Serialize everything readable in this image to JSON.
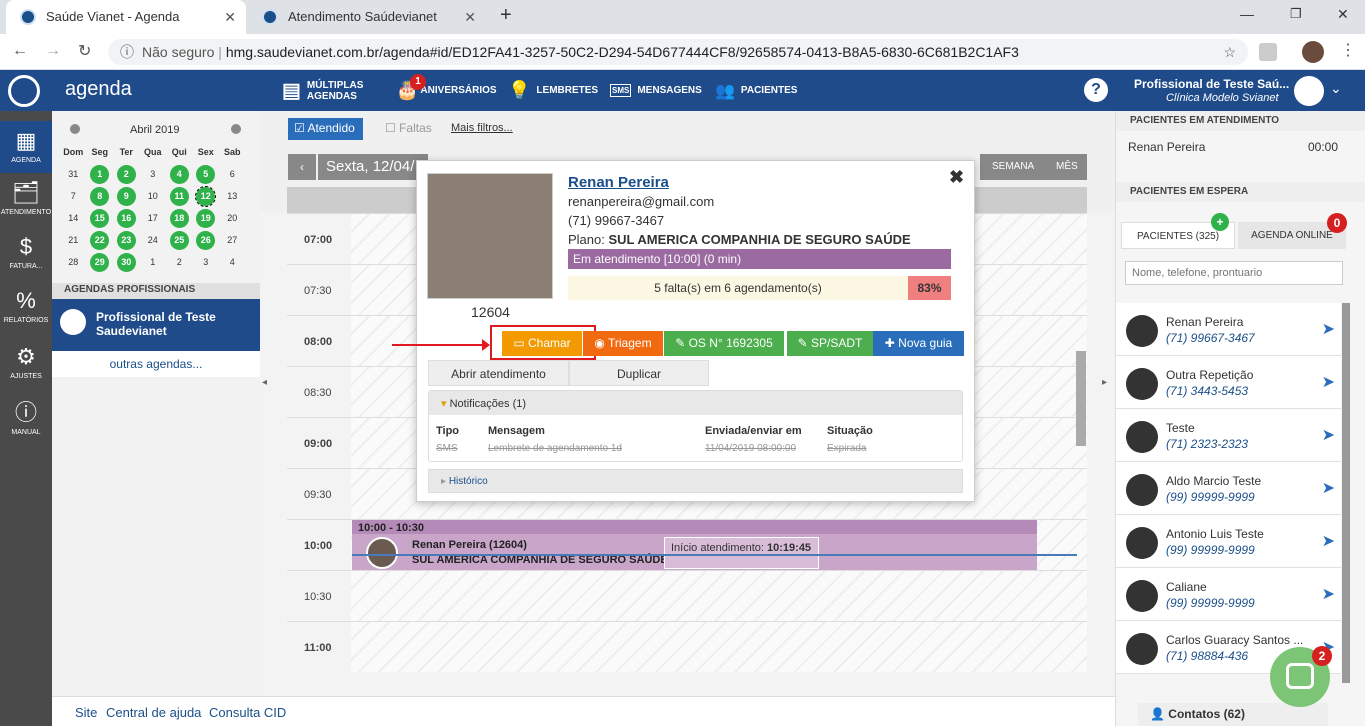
{
  "browser": {
    "tabs": [
      {
        "title": "Saúde Vianet - Agenda"
      },
      {
        "title": "Atendimento Saúdevianet"
      }
    ],
    "security": "Não seguro",
    "url": "hmg.saudevianet.com.br/agenda#id/ED12FA41-3257-50C2-D294-54D677444CF8/92658574-0413-B8A5-6830-6C681B2C1AF3"
  },
  "header": {
    "app": "agenda",
    "nav": [
      {
        "l1": "MÚLTIPLAS",
        "l2": "AGENDAS"
      },
      {
        "label": "ANIVERSÁRIOS",
        "badge": "1"
      },
      {
        "label": "LEMBRETES"
      },
      {
        "label": "MENSAGENS"
      },
      {
        "label": "PACIENTES"
      }
    ],
    "user": "Profissional de Teste Saú...",
    "clinic": "Clínica Modelo Svianet"
  },
  "leftbar": [
    "AGENDA",
    "ATENDIMENTO",
    "FATURA...",
    "RELATÓRIOS",
    "AJUSTES",
    "MANUAL"
  ],
  "calendar": {
    "month": "Abril 2019",
    "dow": [
      "Dom",
      "Seg",
      "Ter",
      "Qua",
      "Qui",
      "Sex",
      "Sab"
    ],
    "weeks": [
      [
        "31",
        "1",
        "2",
        "3",
        "4",
        "5",
        "6"
      ],
      [
        "7",
        "8",
        "9",
        "10",
        "11",
        "12",
        "13"
      ],
      [
        "14",
        "15",
        "16",
        "17",
        "18",
        "19",
        "20"
      ],
      [
        "21",
        "22",
        "23",
        "24",
        "25",
        "26",
        "27"
      ],
      [
        "28",
        "29",
        "30",
        "1",
        "2",
        "3",
        "4"
      ]
    ],
    "green": [
      "1",
      "2",
      "4",
      "5",
      "8",
      "9",
      "11",
      "12",
      "15",
      "16",
      "18",
      "19",
      "22",
      "23",
      "25",
      "26",
      "29",
      "30"
    ]
  },
  "sidebar": {
    "section": "AGENDAS PROFISSIONAIS",
    "prof": "Profissional de Teste Saudevianet",
    "other": "outras agendas..."
  },
  "filters": {
    "atendido": "Atendido",
    "faltas": "Faltas",
    "mais": "Mais filtros..."
  },
  "toolbar": {
    "date": "Sexta, 12/04/",
    "semana": "SEMANA",
    "mes": "MÊS"
  },
  "times": [
    "07:00",
    "07:30",
    "08:00",
    "08:30",
    "09:00",
    "09:30",
    "10:00",
    "10:30",
    "11:00"
  ],
  "appointment": {
    "time": "10:00 - 10:30",
    "patient": "Renan Pereira (12604)",
    "plan": "SUL AMERICA COMPANHIA DE SEGURO SAÚDE",
    "start_label": "Início atendimento:",
    "start_time": "10:19:45"
  },
  "popup": {
    "name": "Renan Pereira",
    "email": "renanpereira@gmail.com",
    "phone": "(71) 99667-3467",
    "plan_label": "Plano:",
    "plan": "SUL AMERICA COMPANHIA DE SEGURO SAÚDE",
    "status": "Em atendimento [10:00] (0 min)",
    "faltas": "5 falta(s) em 6 agendamento(s)",
    "pct": "83%",
    "id": "12604",
    "btns": [
      "Chamar",
      "Triagem",
      "OS N° 1692305",
      "SP/SADT",
      "Nova guia"
    ],
    "abrir": "Abrir atendimento",
    "duplicar": "Duplicar",
    "notif": "Notificações (1)",
    "cols": [
      "Tipo",
      "Mensagem",
      "Enviada/enviar em",
      "Situação"
    ],
    "row": [
      "SMS",
      "Lembrete de agendamento 1d",
      "11/04/2019 08:00:00",
      "Expirada"
    ],
    "hist": "Histórico"
  },
  "right": {
    "em_atend": "PACIENTES EM ATENDIMENTO",
    "atend_name": "Renan Pereira",
    "atend_time": "00:00",
    "espera": "PACIENTES EM ESPERA",
    "tab1": "PACIENTES (325)",
    "tab2": "AGENDA ONLINE",
    "tab2badge": "0",
    "search": "Nome, telefone, prontuario",
    "patients": [
      {
        "n": "Renan Pereira",
        "p": "(71) 99667-3467"
      },
      {
        "n": "Outra Repetição",
        "p": "(71) 3443-5453"
      },
      {
        "n": "Teste",
        "p": "(71) 2323-2323"
      },
      {
        "n": "Aldo Marcio Teste",
        "p": "(99) 99999-9999"
      },
      {
        "n": "Antonio Luis Teste",
        "p": "(99) 99999-9999"
      },
      {
        "n": "Caliane",
        "p": "(99) 99999-9999"
      },
      {
        "n": "Carlos Guaracy Santos ...",
        "p": "(71) 98884-436"
      }
    ],
    "contatos": "Contatos (62)",
    "chatbadge": "2"
  },
  "footer": [
    "Site",
    "Central de ajuda",
    "Consulta CID"
  ]
}
